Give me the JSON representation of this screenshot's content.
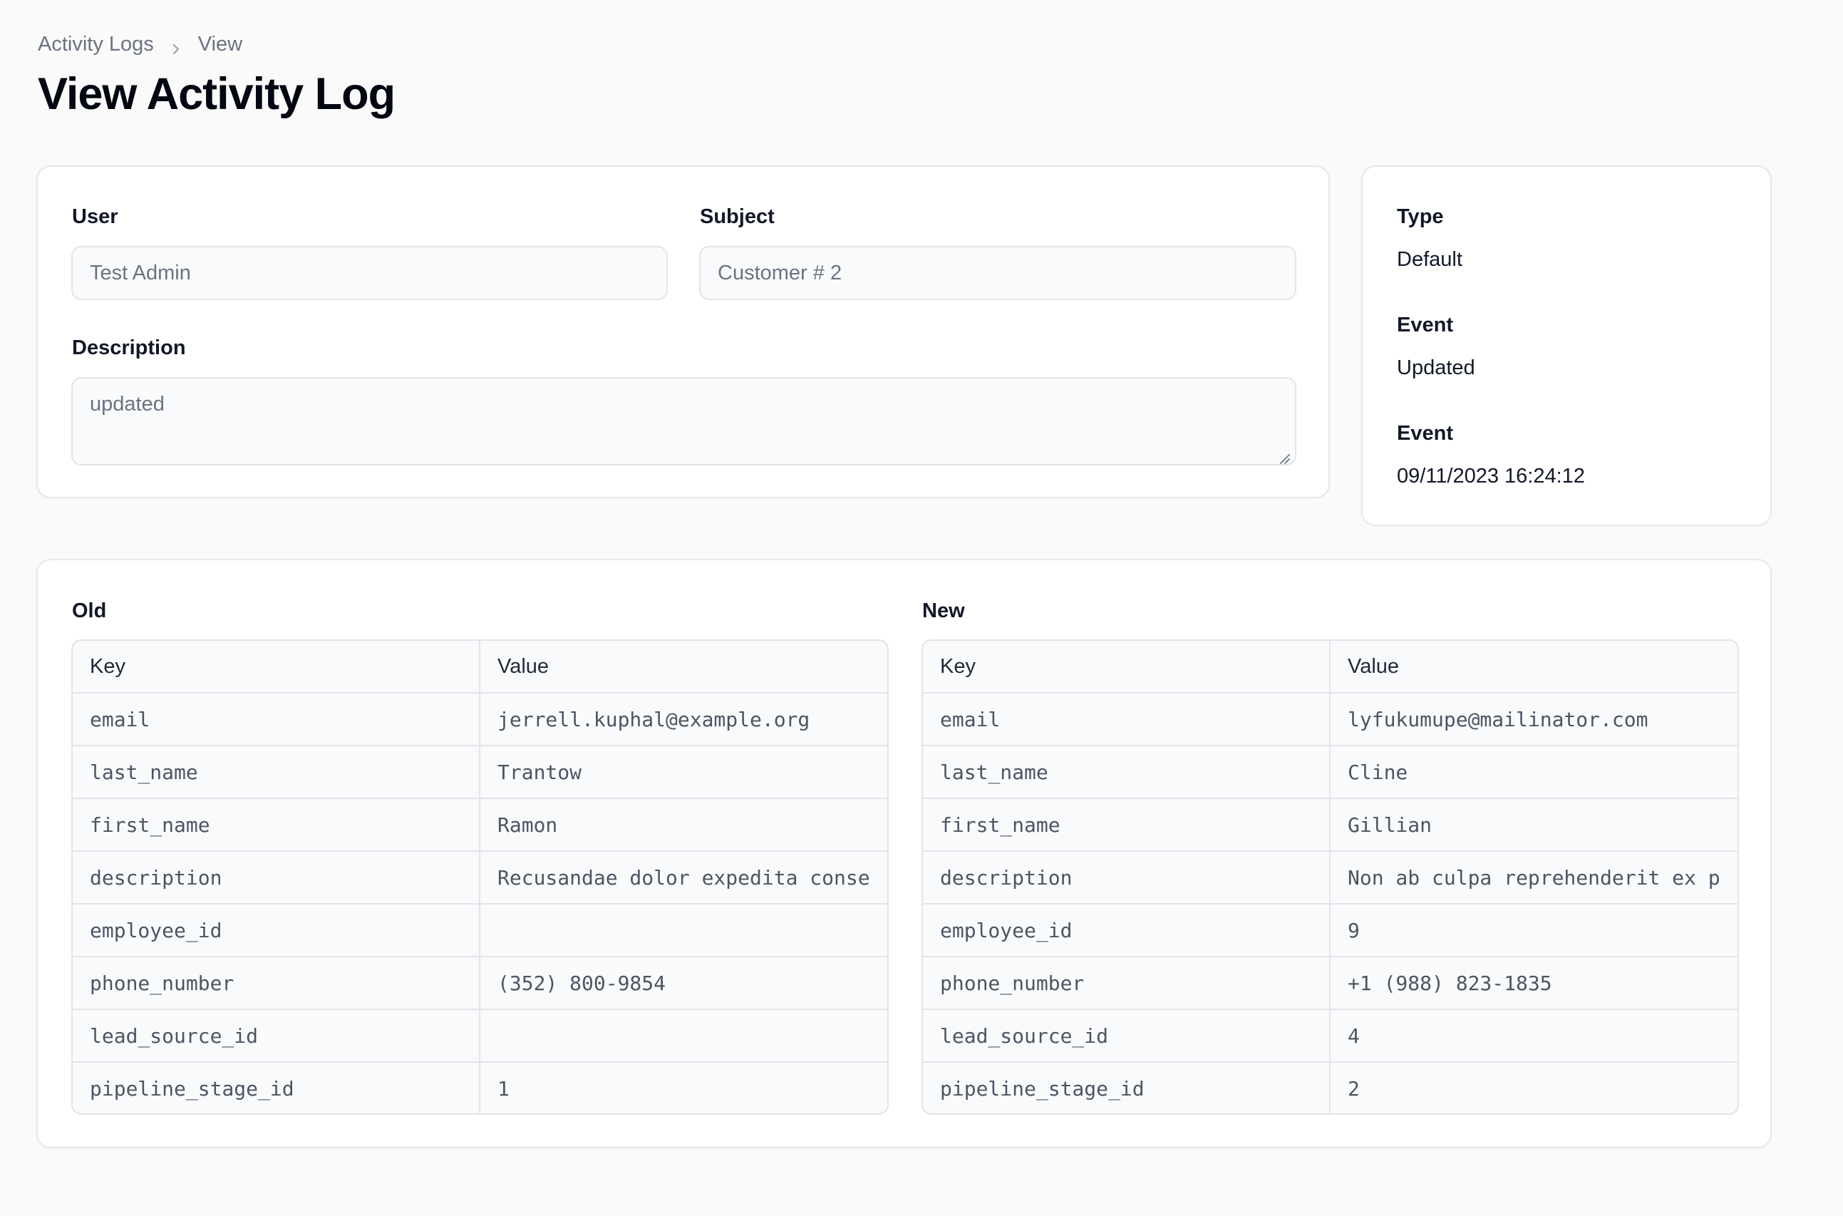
{
  "breadcrumb": {
    "parent": "Activity Logs",
    "current": "View"
  },
  "page": {
    "title": "View Activity Log"
  },
  "form": {
    "user": {
      "label": "User",
      "value": "Test Admin"
    },
    "subject": {
      "label": "Subject",
      "value": "Customer # 2"
    },
    "description": {
      "label": "Description",
      "value": "updated"
    }
  },
  "details": {
    "type": {
      "label": "Type",
      "value": "Default"
    },
    "event": {
      "label": "Event",
      "value": "Updated"
    },
    "date": {
      "label": "Event",
      "value": "09/11/2023 16:24:12"
    }
  },
  "properties": {
    "old": {
      "label": "Old",
      "key_header": "Key",
      "value_header": "Value",
      "rows": [
        {
          "key": "email",
          "value": "jerrell.kuphal@example.org"
        },
        {
          "key": "last_name",
          "value": "Trantow"
        },
        {
          "key": "first_name",
          "value": "Ramon"
        },
        {
          "key": "description",
          "value": "Recusandae dolor expedita conse"
        },
        {
          "key": "employee_id",
          "value": ""
        },
        {
          "key": "phone_number",
          "value": "(352) 800-9854"
        },
        {
          "key": "lead_source_id",
          "value": ""
        },
        {
          "key": "pipeline_stage_id",
          "value": "1"
        }
      ]
    },
    "new": {
      "label": "New",
      "key_header": "Key",
      "value_header": "Value",
      "rows": [
        {
          "key": "email",
          "value": "lyfukumupe@mailinator.com"
        },
        {
          "key": "last_name",
          "value": "Cline"
        },
        {
          "key": "first_name",
          "value": "Gillian"
        },
        {
          "key": "description",
          "value": "Non ab culpa reprehenderit ex p"
        },
        {
          "key": "employee_id",
          "value": "9"
        },
        {
          "key": "phone_number",
          "value": "+1 (988) 823-1835"
        },
        {
          "key": "lead_source_id",
          "value": "4"
        },
        {
          "key": "pipeline_stage_id",
          "value": "2"
        }
      ]
    }
  }
}
